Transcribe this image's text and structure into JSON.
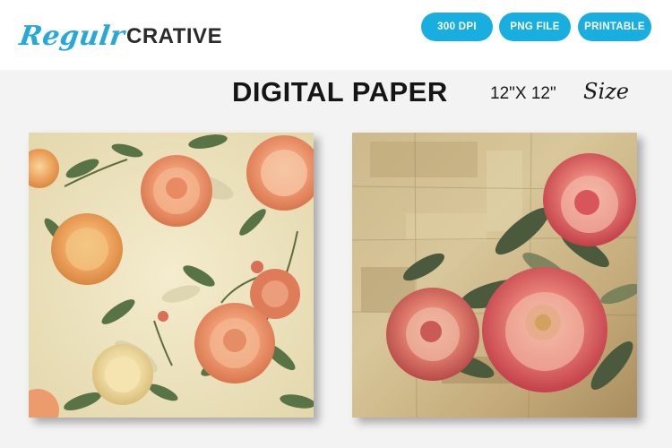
{
  "brand": {
    "script": "Regulr",
    "block": "CRATIVE"
  },
  "badges": [
    "300 DPI",
    "PNG FILE",
    "PRINTABLE"
  ],
  "heading": {
    "title": "DIGITAL PAPER",
    "dimensions": "12\"X 12\"",
    "size_word": "Size"
  },
  "colors": {
    "brand_blue": "#27a9d8",
    "badge_blue": "#18afe0"
  },
  "papers": [
    {
      "name": "cream-peony-floral-pattern"
    },
    {
      "name": "vintage-red-peony-pattern"
    }
  ]
}
